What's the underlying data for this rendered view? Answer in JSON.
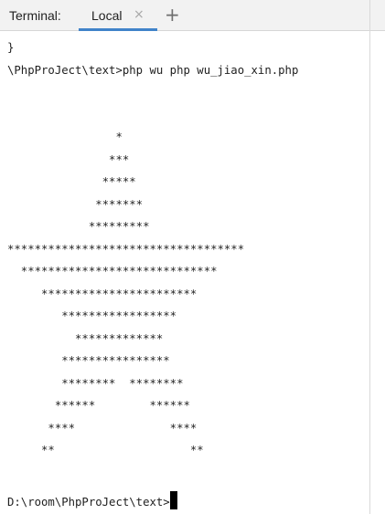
{
  "tabbar": {
    "title": "Terminal:",
    "tab_label": "Local",
    "close_glyph": "×",
    "add_glyph": "+"
  },
  "terminal": {
    "lines": [
      "}",
      "\\PhpProJect\\text>php wu php wu_jiao_xin.php",
      "",
      "",
      "                *",
      "               ***",
      "              *****",
      "             *******",
      "            *********",
      "***********************************",
      "  *****************************",
      "     ***********************",
      "        *****************",
      "          *************",
      "        ****************",
      "        ********  ********",
      "       ******        ******",
      "      ****              ****",
      "     **                    **"
    ],
    "prompt": "D:\\room\\PhpProJect\\text>"
  }
}
